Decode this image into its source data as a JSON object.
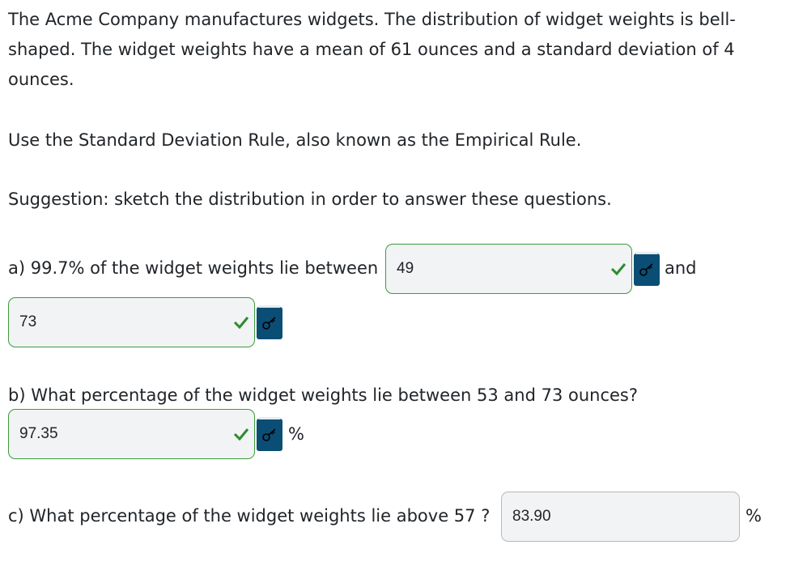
{
  "intro": "The Acme Company manufactures widgets. The distribution of widget weights is bell-shaped. The widget weights have a mean of 61 ounces and a standard deviation of 4 ounces.",
  "rule_text": "Use the Standard Deviation Rule, also known as the Empirical Rule.",
  "suggestion": "Suggestion: sketch the distribution in order to answer these questions.",
  "part_a": {
    "prompt": "a) 99.7% of the widget weights lie between",
    "answer1": "49",
    "connector": "and",
    "answer2": "73"
  },
  "part_b": {
    "prompt": "b) What percentage of the widget weights lie between 53 and 73 ounces?",
    "answer": "97.35",
    "unit": "%"
  },
  "part_c": {
    "prompt": "c) What percentage of the widget weights lie above 57 ?",
    "answer": "83.90",
    "unit": "%"
  },
  "icons": {
    "check": "checkmark-icon",
    "key": "key-icon"
  },
  "colors": {
    "correct_border": "#3c9b3c",
    "key_button_bg": "#0a4e76",
    "field_bg": "#f1f3f4"
  }
}
